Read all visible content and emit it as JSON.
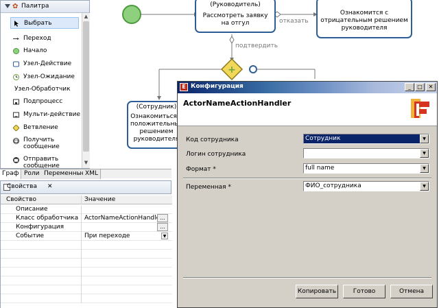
{
  "palette": {
    "title": "Палитра",
    "items": [
      {
        "label": "Выбрать",
        "icon": "cursor-icon"
      },
      {
        "label": "Переход",
        "icon": "arrow-icon"
      },
      {
        "label": "Начало",
        "icon": "start-icon"
      },
      {
        "label": "Узел-Действие",
        "icon": "action-node-icon"
      },
      {
        "label": "Узел-Ожидание",
        "icon": "wait-node-icon"
      },
      {
        "label": "Узел-Обработчик",
        "icon": ""
      },
      {
        "label": "Подпроцесс",
        "icon": "subprocess-icon"
      },
      {
        "label": "Мульти-действие",
        "icon": "multi-action-icon"
      },
      {
        "label": "Ветвление",
        "icon": "branch-icon"
      },
      {
        "label": "Получить сообщение",
        "icon": "receive-message-icon"
      },
      {
        "label": "Отправить сообщение",
        "icon": "send-message-icon"
      }
    ]
  },
  "tabs": [
    "Граф",
    "Роли",
    "Переменные",
    "XML"
  ],
  "canvas": {
    "node_top_role": "(Руководитель)",
    "node_top_text": "Рассмотреть заявку на отгул",
    "node_right_text": "Ознакомится с отрицательным решением руководителя",
    "node_left_role": "(Сотрудник)",
    "node_left_text": "Ознакомиться с положительным решением руководителя",
    "edge_reject": "отказать",
    "edge_confirm": "подтвердить"
  },
  "properties": {
    "panel_title": "Свойства",
    "col_property": "Свойство",
    "col_value": "Значение",
    "rows": [
      {
        "name": "Описание",
        "value": ""
      },
      {
        "name": "Класс обработчика",
        "value": "ActorNameActionHandler",
        "button": "..."
      },
      {
        "name": "Конфигурация",
        "value": "",
        "button": "..."
      },
      {
        "name": "Событие",
        "value": "При переходе"
      }
    ]
  },
  "dialog": {
    "title": "Конфигурация",
    "header": "ActorNameActionHandler",
    "fields": [
      {
        "label": "Код сотрудника",
        "value": "Сотрудник"
      },
      {
        "label": "Логин сотрудника",
        "value": ""
      },
      {
        "label": "Формат *",
        "value": "full name"
      },
      {
        "label": "Переменная *",
        "value": "ФИО_сотрудника"
      }
    ],
    "buttons": {
      "copy": "Копировать",
      "ok": "Готово",
      "cancel": "Отмена"
    }
  },
  "colors": {
    "accent": "#2d5d95",
    "title_bar": "#0a246a",
    "gateway": "#e0c040",
    "start": "#7cc36b"
  }
}
